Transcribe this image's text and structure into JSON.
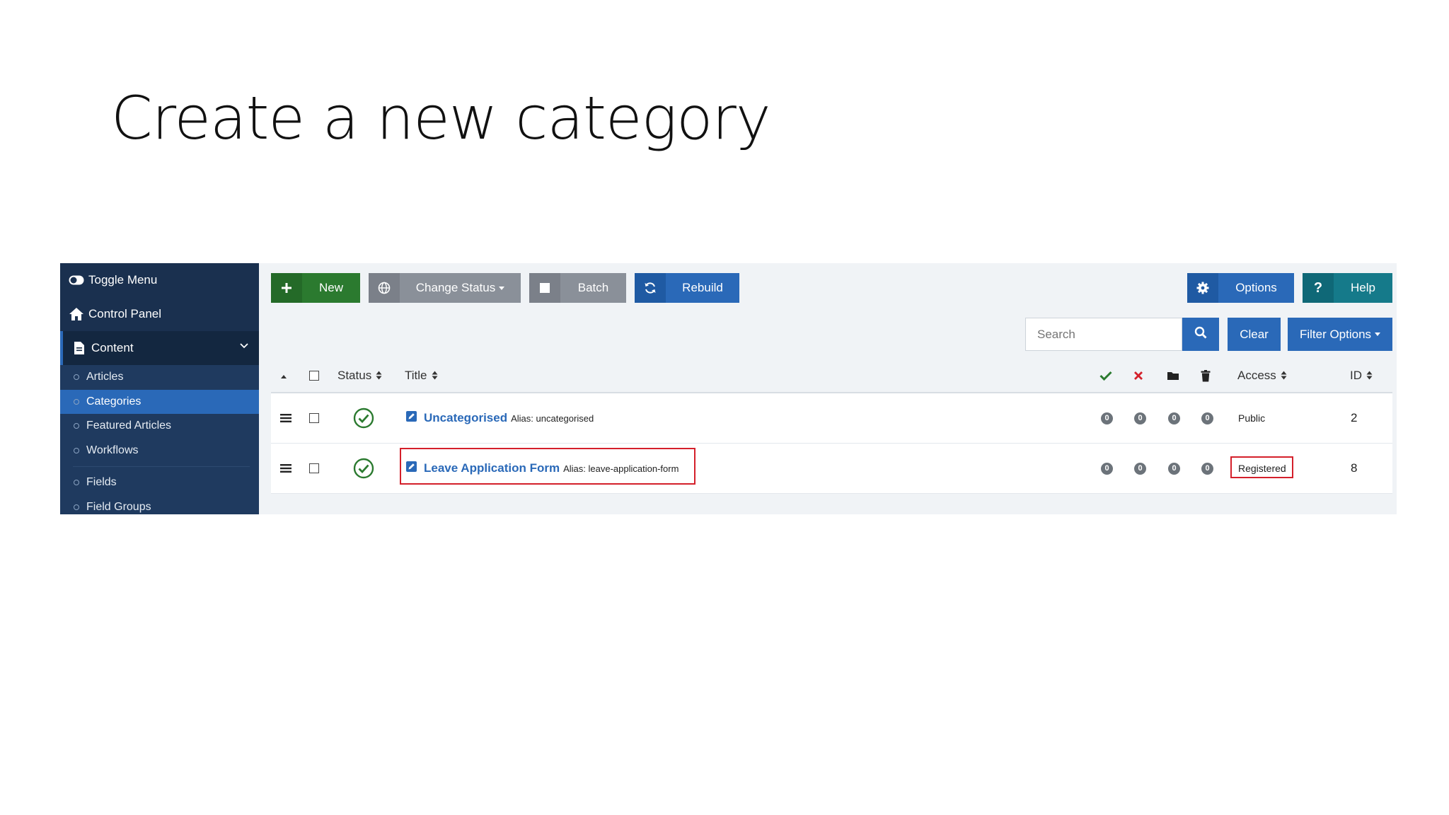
{
  "slide": {
    "title": "Create a new category"
  },
  "sidebar": {
    "toggle_menu": "Toggle Menu",
    "control_panel": "Control Panel",
    "content": "Content",
    "items": [
      {
        "label": "Articles"
      },
      {
        "label": "Categories",
        "active": true
      },
      {
        "label": "Featured Articles"
      },
      {
        "label": "Workflows"
      },
      {
        "label": "Fields"
      },
      {
        "label": "Field Groups"
      }
    ]
  },
  "toolbar": {
    "new_label": "New",
    "change_status_label": "Change Status",
    "batch_label": "Batch",
    "rebuild_label": "Rebuild",
    "options_label": "Options",
    "help_label": "Help"
  },
  "filters": {
    "search_placeholder": "Search",
    "clear_label": "Clear",
    "filter_options_label": "Filter Options"
  },
  "table": {
    "columns": {
      "status": "Status",
      "title": "Title",
      "access": "Access",
      "id": "ID"
    },
    "alias_prefix": "Alias:",
    "rows": [
      {
        "title": "Uncategorised",
        "alias": "uncategorised",
        "counts": [
          "0",
          "0",
          "0",
          "0"
        ],
        "access": "Public",
        "id": "2"
      },
      {
        "title": "Leave Application Form",
        "alias": "leave-application-form",
        "counts": [
          "0",
          "0",
          "0",
          "0"
        ],
        "access": "Registered",
        "id": "8"
      }
    ]
  },
  "colors": {
    "primary": "#2a69b8",
    "success": "#2b7a2f",
    "sidebar": "#1f3a5f",
    "highlight": "#d4202b"
  }
}
